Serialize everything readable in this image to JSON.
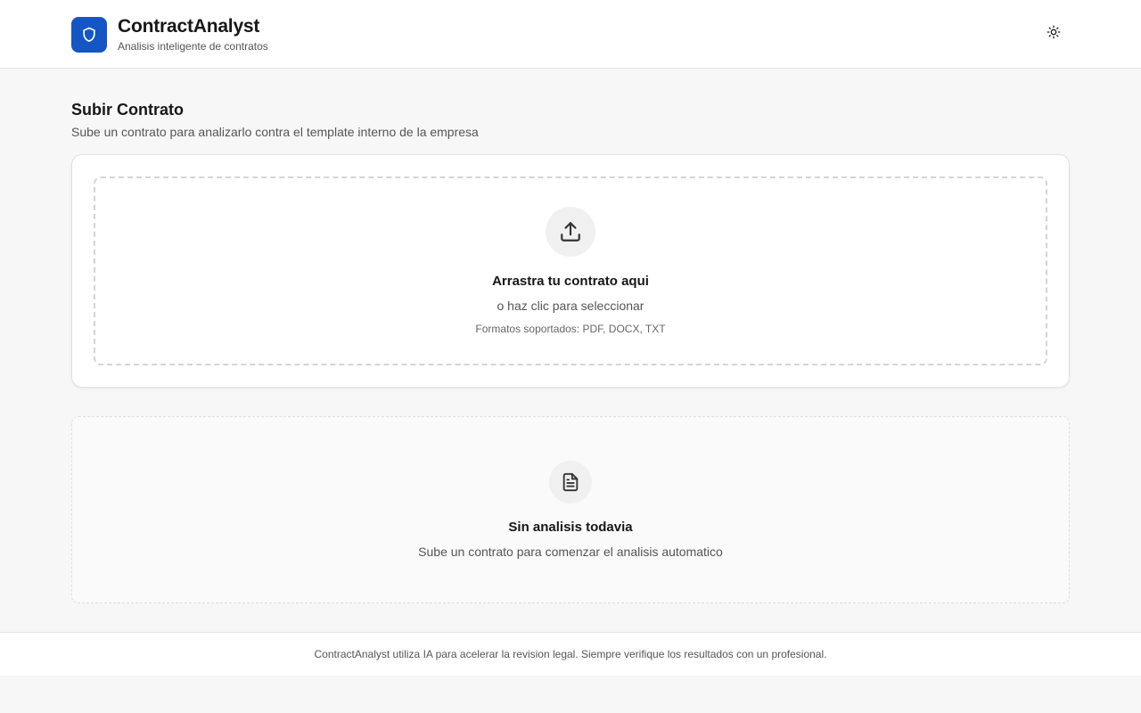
{
  "app": {
    "title": "ContractAnalyst",
    "subtitle": "Analisis inteligente de contratos",
    "brand_color": "#1456c5",
    "logo_icon": "shield-icon",
    "theme_icon": "sun-icon"
  },
  "upload": {
    "heading": "Subir Contrato",
    "description": "Sube un contrato para analizarlo contra el template interno de la empresa",
    "dropzone": {
      "icon": "upload-icon",
      "title": "Arrastra tu contrato aqui",
      "subtitle": "o haz clic para seleccionar",
      "formats": "Formatos soportados: PDF, DOCX, TXT"
    }
  },
  "empty_state": {
    "icon": "document-icon",
    "title": "Sin analisis todavia",
    "subtitle": "Sube un contrato para comenzar el analisis automatico"
  },
  "footer": {
    "text": "ContractAnalyst utiliza IA para acelerar la revision legal. Siempre verifique los resultados con un profesional."
  }
}
